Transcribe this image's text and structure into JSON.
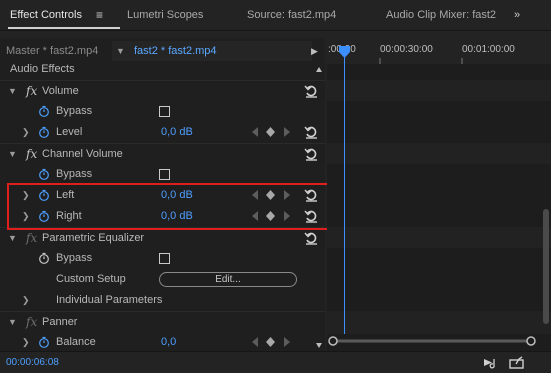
{
  "tabs": {
    "effect_controls": "Effect Controls",
    "menu_glyph": "≡",
    "lumetri": "Lumetri Scopes",
    "source": "Source: fast2.mp4",
    "audio_mixer": "Audio Clip Mixer: fast2",
    "overflow": "»"
  },
  "source_bar": {
    "master": "Master * fast2.mp4",
    "clip": "fast2 * fast2.mp4"
  },
  "effects": {
    "section": "Audio Effects",
    "volume": {
      "name": "Volume",
      "bypass": "Bypass",
      "level": "Level",
      "level_value": "0,0 dB"
    },
    "channel_volume": {
      "name": "Channel Volume",
      "bypass": "Bypass",
      "left": "Left",
      "left_value": "0,0 dB",
      "right": "Right",
      "right_value": "0,0 dB"
    },
    "parametric_eq": {
      "name": "Parametric Equalizer",
      "bypass": "Bypass",
      "custom_setup": "Custom Setup",
      "edit": "Edit...",
      "individual": "Individual Parameters"
    },
    "panner": {
      "name": "Panner",
      "balance": "Balance",
      "balance_value": "0,0"
    },
    "fx_glyph": "fx"
  },
  "timeline": {
    "tc0": ":00:00",
    "tc1": "00:00:30:00",
    "tc2": "00:01:00:00"
  },
  "status": {
    "timecode": "00:00:06:08"
  },
  "colors": {
    "accent": "#4d9fff",
    "highlight": "#e01e1e",
    "background": "#232323"
  }
}
